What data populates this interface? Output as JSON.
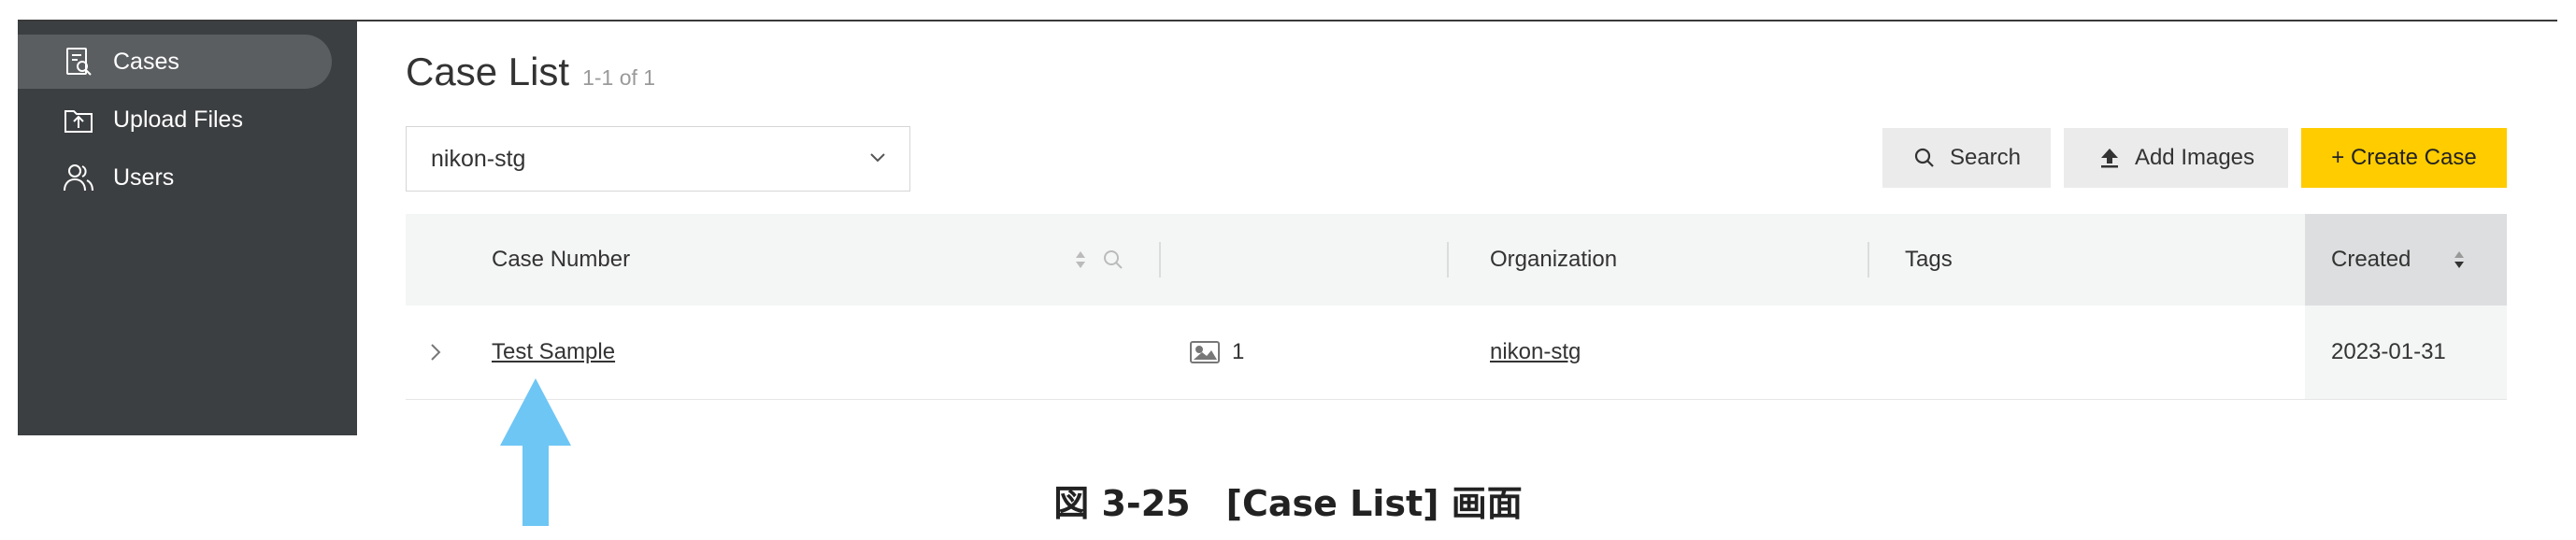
{
  "sidebar": {
    "items": [
      {
        "label": "Cases",
        "icon": "case-search-icon",
        "active": true
      },
      {
        "label": "Upload Files",
        "icon": "upload-file-icon",
        "active": false
      },
      {
        "label": "Users",
        "icon": "users-icon",
        "active": false
      }
    ]
  },
  "header": {
    "title": "Case List",
    "count": "1-1 of 1"
  },
  "filter": {
    "organization": "nikon-stg"
  },
  "toolbar": {
    "search_label": "Search",
    "add_images_label": "Add Images",
    "create_case_label": "+ Create Case"
  },
  "table": {
    "columns": {
      "case_number": "Case Number",
      "organization": "Organization",
      "tags": "Tags",
      "created": "Created"
    },
    "rows": [
      {
        "case_number": "Test Sample",
        "images": "1",
        "organization": "nikon-stg",
        "tags": "",
        "created": "2023-01-31"
      }
    ]
  },
  "caption": "図 3-25　[Case List] 画面",
  "colors": {
    "sidebar_bg": "#3c3f41",
    "sidebar_active": "#5b5e61",
    "create_button": "#ffcc00",
    "arrow": "#6ec6f5"
  }
}
